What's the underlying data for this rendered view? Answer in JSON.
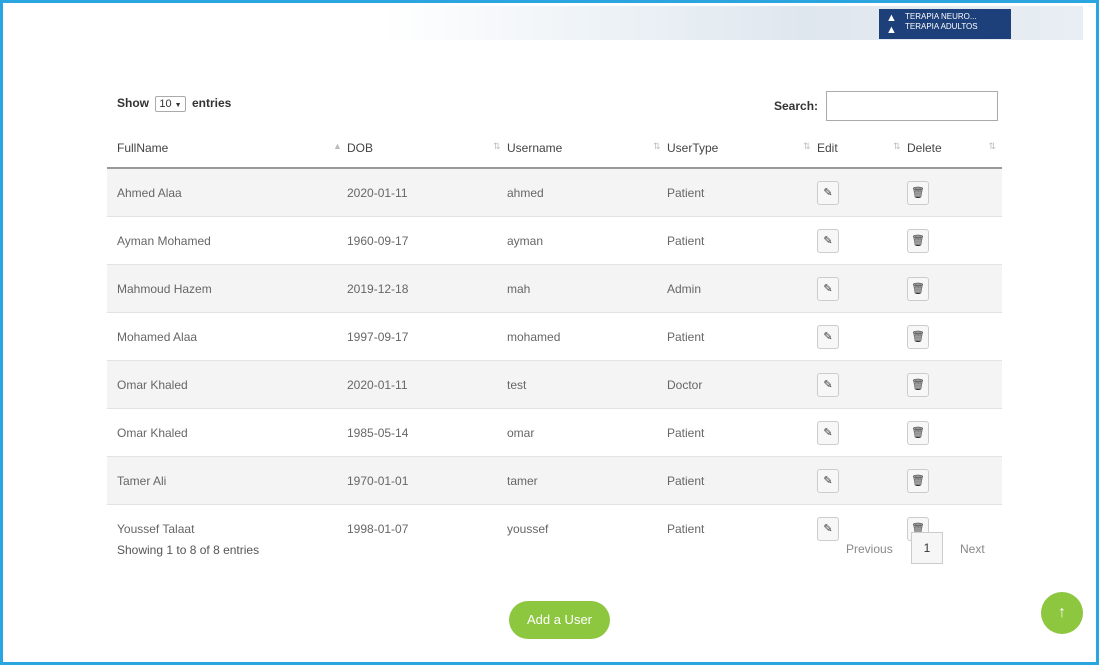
{
  "banner": {
    "sign_line1": "TERAPIA NEURO...",
    "sign_line2": "TERAPIA ADULTOS"
  },
  "length": {
    "label_show": "Show",
    "selected": "10",
    "label_entries": "entries"
  },
  "search": {
    "label": "Search:",
    "value": ""
  },
  "columns": [
    "FullName",
    "DOB",
    "Username",
    "UserType",
    "Edit",
    "Delete"
  ],
  "rows": [
    {
      "fullname": "Ahmed Alaa",
      "dob": "2020-01-11",
      "username": "ahmed",
      "usertype": "Patient"
    },
    {
      "fullname": "Ayman Mohamed",
      "dob": "1960-09-17",
      "username": "ayman",
      "usertype": "Patient"
    },
    {
      "fullname": "Mahmoud Hazem",
      "dob": "2019-12-18",
      "username": "mah",
      "usertype": "Admin"
    },
    {
      "fullname": "Mohamed Alaa",
      "dob": "1997-09-17",
      "username": "mohamed",
      "usertype": "Patient"
    },
    {
      "fullname": "Omar Khaled",
      "dob": "2020-01-11",
      "username": "test",
      "usertype": "Doctor"
    },
    {
      "fullname": "Omar Khaled",
      "dob": "1985-05-14",
      "username": "omar",
      "usertype": "Patient"
    },
    {
      "fullname": "Tamer Ali",
      "dob": "1970-01-01",
      "username": "tamer",
      "usertype": "Patient"
    },
    {
      "fullname": "Youssef Talaat",
      "dob": "1998-01-07",
      "username": "youssef",
      "usertype": "Patient"
    }
  ],
  "info": "Showing 1 to 8 of 8 entries",
  "pagination": {
    "previous": "Previous",
    "current": "1",
    "next": "Next"
  },
  "add_button": "Add a User",
  "icons": {
    "edit": "pencil-icon",
    "delete": "trash-icon",
    "scroll_top": "arrow-up-icon"
  },
  "colors": {
    "accent_green": "#8dc63f",
    "frame_blue": "#2aa5e0"
  }
}
